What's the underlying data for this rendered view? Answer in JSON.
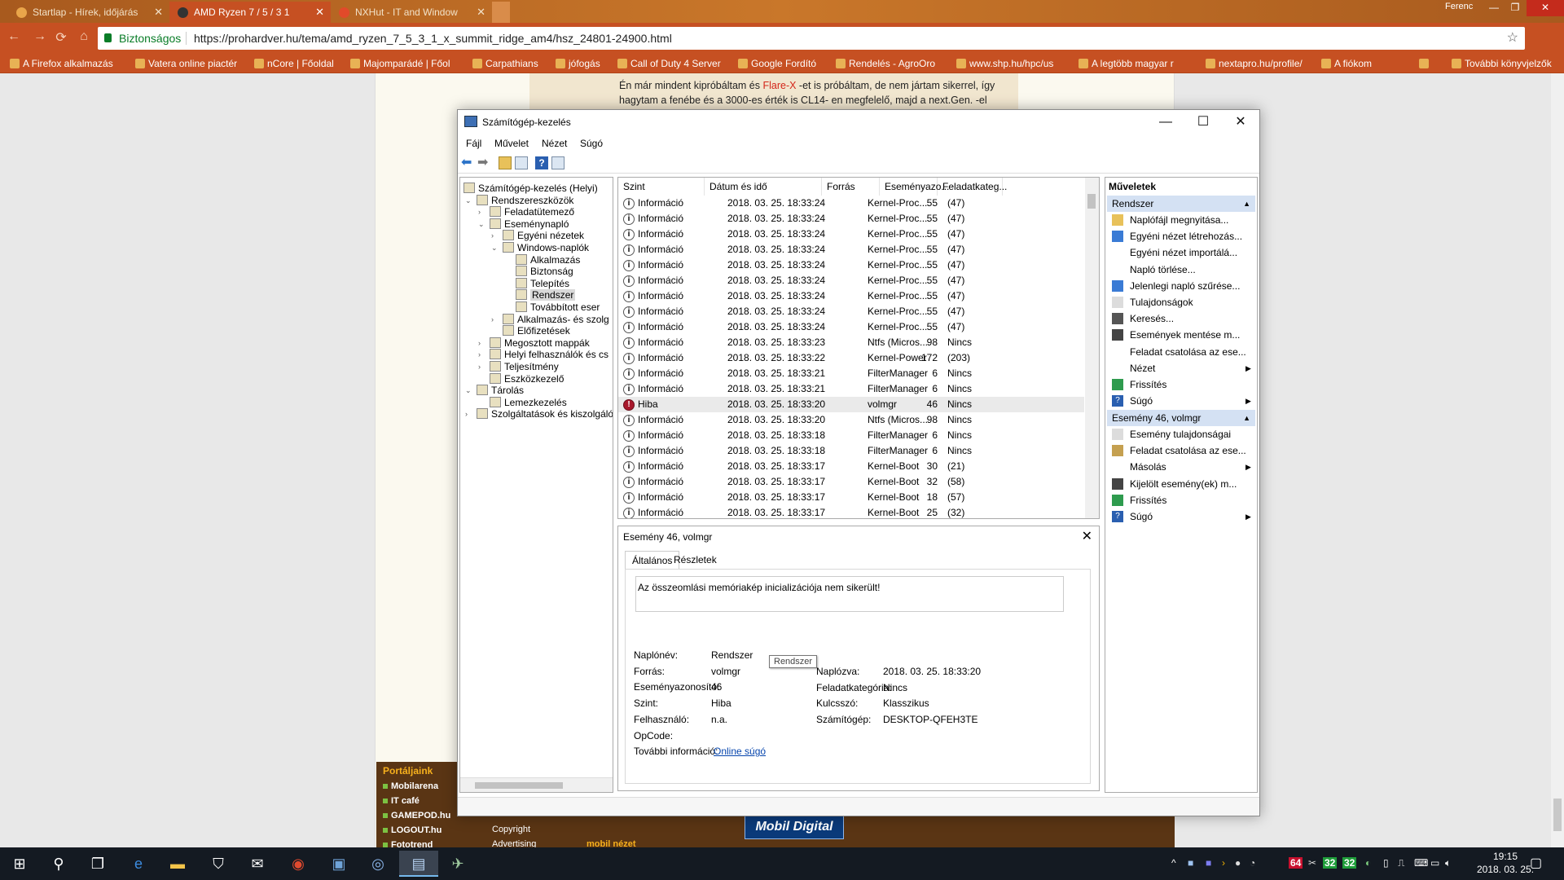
{
  "browser": {
    "tabs": [
      {
        "title": "Startlap - Hírek, időjárás"
      },
      {
        "title": "AMD Ryzen 7 / 5 / 3 1"
      },
      {
        "title": "NXHut - IT and Window"
      }
    ],
    "user": "Ferenc",
    "security_label": "Biztonságos",
    "url": "https://prohardver.hu/tema/amd_ryzen_7_5_3_1_x_summit_ridge_am4/hsz_24801-24900.html",
    "bookmarks": [
      "A Firefox alkalmazás",
      "Vatera online piactér",
      "nCore | Főoldal",
      "Majomparádé | Főol",
      "Carpathians",
      "jófogás",
      "Call of Duty 4 Server",
      "Google Fordító",
      "Rendelés - AgroOro",
      "www.shp.hu/hpc/us",
      "A legtöbb magyar r",
      "nextapro.hu/profile/",
      "A fiókom"
    ],
    "bookmarks_more": "»",
    "other_bookmarks": "További könyvjelzők"
  },
  "page": {
    "post_line1_a": "Én már mindent kipróbáltam és ",
    "post_line1_hl": "Flare-X",
    "post_line1_b": " -et is próbáltam, de nem jártam sikerrel, így",
    "post_line2": "hagytam a fenébe és a 3000-es érték is CL14- en megfelelő, majd a next.Gen. -el",
    "portal_title": "Portáljaink",
    "portal_links": [
      "Mobilarena",
      "IT café",
      "GAMEPOD.hu",
      "LOGOUT.hu",
      "Fototrend"
    ],
    "footer_links": [
      "Copyright",
      "Advertising"
    ],
    "footer_brand": "mobil nézet",
    "mobil_digital": "Mobil Digital"
  },
  "window": {
    "title": "Számítógép-kezelés",
    "menu": [
      "Fájl",
      "Művelet",
      "Nézet",
      "Súgó"
    ],
    "tree": [
      {
        "label": "Számítógép-kezelés (Helyi)",
        "level": 0,
        "expander": ""
      },
      {
        "label": "Rendszereszközök",
        "level": 1,
        "expander": "v"
      },
      {
        "label": "Feladatütemező",
        "level": 2,
        "expander": ">"
      },
      {
        "label": "Eseménynapló",
        "level": 2,
        "expander": "v"
      },
      {
        "label": "Egyéni nézetek",
        "level": 3,
        "expander": ">"
      },
      {
        "label": "Windows-naplók",
        "level": 3,
        "expander": "v"
      },
      {
        "label": "Alkalmazás",
        "level": 4,
        "expander": ""
      },
      {
        "label": "Biztonság",
        "level": 4,
        "expander": ""
      },
      {
        "label": "Telepítés",
        "level": 4,
        "expander": ""
      },
      {
        "label": "Rendszer",
        "level": 4,
        "expander": "",
        "selected": true
      },
      {
        "label": "Továbbított eser",
        "level": 4,
        "expander": ""
      },
      {
        "label": "Alkalmazás- és szolg",
        "level": 3,
        "expander": ">"
      },
      {
        "label": "Előfizetések",
        "level": 3,
        "expander": ""
      },
      {
        "label": "Megosztott mappák",
        "level": 2,
        "expander": ">"
      },
      {
        "label": "Helyi felhasználók és cs",
        "level": 2,
        "expander": ">"
      },
      {
        "label": "Teljesítmény",
        "level": 2,
        "expander": ">"
      },
      {
        "label": "Eszközkezelő",
        "level": 2,
        "expander": ""
      },
      {
        "label": "Tárolás",
        "level": 1,
        "expander": "v"
      },
      {
        "label": "Lemezkezelés",
        "level": 2,
        "expander": ""
      },
      {
        "label": "Szolgáltatások és kiszolgáló",
        "level": 1,
        "expander": ">"
      }
    ],
    "columns": [
      "Szint",
      "Dátum és idő",
      "Forrás",
      "Eseményazo...",
      "Feladatkateg..."
    ],
    "events": [
      [
        "Információ",
        "2018. 03. 25. 18:33:24",
        "Kernel-Proc...",
        "55",
        "(47)"
      ],
      [
        "Információ",
        "2018. 03. 25. 18:33:24",
        "Kernel-Proc...",
        "55",
        "(47)"
      ],
      [
        "Információ",
        "2018. 03. 25. 18:33:24",
        "Kernel-Proc...",
        "55",
        "(47)"
      ],
      [
        "Információ",
        "2018. 03. 25. 18:33:24",
        "Kernel-Proc...",
        "55",
        "(47)"
      ],
      [
        "Információ",
        "2018. 03. 25. 18:33:24",
        "Kernel-Proc...",
        "55",
        "(47)"
      ],
      [
        "Információ",
        "2018. 03. 25. 18:33:24",
        "Kernel-Proc...",
        "55",
        "(47)"
      ],
      [
        "Információ",
        "2018. 03. 25. 18:33:24",
        "Kernel-Proc...",
        "55",
        "(47)"
      ],
      [
        "Információ",
        "2018. 03. 25. 18:33:24",
        "Kernel-Proc...",
        "55",
        "(47)"
      ],
      [
        "Információ",
        "2018. 03. 25. 18:33:24",
        "Kernel-Proc...",
        "55",
        "(47)"
      ],
      [
        "Információ",
        "2018. 03. 25. 18:33:23",
        "Ntfs (Micros...",
        "98",
        "Nincs"
      ],
      [
        "Információ",
        "2018. 03. 25. 18:33:22",
        "Kernel-Power",
        "172",
        "(203)"
      ],
      [
        "Információ",
        "2018. 03. 25. 18:33:21",
        "FilterManager",
        "6",
        "Nincs"
      ],
      [
        "Információ",
        "2018. 03. 25. 18:33:21",
        "FilterManager",
        "6",
        "Nincs"
      ],
      [
        "Hiba",
        "2018. 03. 25. 18:33:20",
        "volmgr",
        "46",
        "Nincs"
      ],
      [
        "Információ",
        "2018. 03. 25. 18:33:20",
        "Ntfs (Micros...",
        "98",
        "Nincs"
      ],
      [
        "Információ",
        "2018. 03. 25. 18:33:18",
        "FilterManager",
        "6",
        "Nincs"
      ],
      [
        "Információ",
        "2018. 03. 25. 18:33:18",
        "FilterManager",
        "6",
        "Nincs"
      ],
      [
        "Információ",
        "2018. 03. 25. 18:33:17",
        "Kernel-Boot",
        "30",
        "(21)"
      ],
      [
        "Információ",
        "2018. 03. 25. 18:33:17",
        "Kernel-Boot",
        "32",
        "(58)"
      ],
      [
        "Információ",
        "2018. 03. 25. 18:33:17",
        "Kernel-Boot",
        "18",
        "(57)"
      ],
      [
        "Információ",
        "2018. 03. 25. 18:33:17",
        "Kernel-Boot",
        "25",
        "(32)"
      ]
    ],
    "selected_row": 13,
    "detail": {
      "header": "Esemény 46, volmgr",
      "tabs": [
        "Általános",
        "Részletek"
      ],
      "description": "Az összeomlási memóriakép inicializációja nem sikerült!",
      "fields_left": [
        {
          "k": "Naplónév:",
          "v": "Rendszer"
        },
        {
          "k": "Forrás:",
          "v": "volmgr"
        },
        {
          "k": "Eseményazonosító:",
          "v": "46"
        },
        {
          "k": "Szint:",
          "v": "Hiba"
        },
        {
          "k": "Felhasználó:",
          "v": "n.a."
        },
        {
          "k": "OpCode:",
          "v": ""
        },
        {
          "k": "További információ:",
          "v": "Online súgó"
        }
      ],
      "fields_right": [
        {
          "k": "Naplózva:",
          "v": "2018. 03. 25. 18:33:20"
        },
        {
          "k": "Feladatkategória:",
          "v": "Nincs"
        },
        {
          "k": "Kulcsszó:",
          "v": "Klasszikus"
        },
        {
          "k": "Számítógép:",
          "v": "DESKTOP-QFEH3TE"
        }
      ],
      "tooltip": "Rendszer"
    },
    "actions": {
      "title": "Műveletek",
      "section1": "Rendszer",
      "items1": [
        {
          "label": "Naplófájl megnyitása...",
          "icon": "folder-open-icon",
          "sub": false
        },
        {
          "label": "Egyéni nézet létrehozás...",
          "icon": "filter-icon",
          "sub": false
        },
        {
          "label": "Egyéni nézet importálá...",
          "icon": "",
          "sub": false
        },
        {
          "label": "Napló törlése...",
          "icon": "",
          "sub": false
        },
        {
          "label": "Jelenlegi napló szűrése...",
          "icon": "filter-icon",
          "sub": false
        },
        {
          "label": "Tulajdonságok",
          "icon": "properties-icon",
          "sub": false
        },
        {
          "label": "Keresés...",
          "icon": "binoculars-icon",
          "sub": false
        },
        {
          "label": "Események mentése m...",
          "icon": "save-icon",
          "sub": false
        },
        {
          "label": "Feladat csatolása az ese...",
          "icon": "",
          "sub": false
        },
        {
          "label": "Nézet",
          "icon": "",
          "sub": true
        },
        {
          "label": "Frissítés",
          "icon": "refresh-icon",
          "sub": false
        },
        {
          "label": "Súgó",
          "icon": "help-icon",
          "sub": true
        }
      ],
      "section2": "Esemény 46, volmgr",
      "items2": [
        {
          "label": "Esemény tulajdonságai",
          "icon": "properties-icon",
          "sub": false
        },
        {
          "label": "Feladat csatolása az ese...",
          "icon": "task-icon",
          "sub": false
        },
        {
          "label": "Másolás",
          "icon": "",
          "sub": true
        },
        {
          "label": "Kijelölt esemény(ek) m...",
          "icon": "save-icon",
          "sub": false
        },
        {
          "label": "Frissítés",
          "icon": "refresh-icon",
          "sub": false
        },
        {
          "label": "Súgó",
          "icon": "help-icon",
          "sub": true
        }
      ]
    }
  },
  "taskbar": {
    "time": "19:15",
    "date": "2018. 03. 25.",
    "tray_numbers": [
      "64",
      "32",
      "32"
    ]
  },
  "colors": {
    "accent": "#c65022",
    "error": "#a8182c",
    "action_section": "#d4e1f3"
  }
}
